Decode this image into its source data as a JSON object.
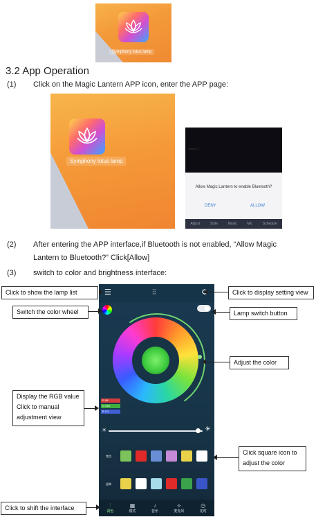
{
  "top_image": {
    "app_label": "Symphony lotus lamp"
  },
  "section": {
    "title": "3.2 App Operation"
  },
  "steps": [
    {
      "num": "(1)",
      "line1": "Click on the Magic Lantern APP icon, enter the APP page:",
      "line2": ""
    },
    {
      "num": "(2)",
      "line1": "After entering the APP interface,if Bluetooth is not enabled, “Allow Magic",
      "line2": "Lantern to Bluetooth?” Click[Allow]"
    },
    {
      "num": "(3)",
      "line1": "switch to color and brightness interface:",
      "line2": ""
    }
  ],
  "big_image": {
    "app_label": "Symphony lotus lamp"
  },
  "bluetooth_dialog": {
    "screen_sub": "Speed 0",
    "message": "Allow Magic Lantern to enable Bluetooth?",
    "deny": "DENY",
    "allow": "ALLOW",
    "tabs": [
      "Adjust",
      "Style",
      "Music",
      "Mic",
      "Schedule"
    ]
  },
  "phone": {
    "rgb": [
      {
        "label": "R",
        "value": "58",
        "color": "#d33c3c"
      },
      {
        "label": "G",
        "value": "240",
        "color": "#3fae3f"
      },
      {
        "label": "B",
        "value": "111",
        "color": "#3f5fd3"
      }
    ],
    "row1_label": "常用",
    "row2_label": "经典",
    "row1_colors": [
      "#7cc25a",
      "#e02a2a",
      "#6a8fd6",
      "#c48ad6",
      "#e9d24a",
      "#ffffff"
    ],
    "row2_colors": [
      "#e9d24a",
      "#ffffff",
      "#a6dde8",
      "#e02a2a",
      "#3aa24a",
      "#3a55c8"
    ],
    "tabs": [
      {
        "icon": "⫶",
        "label": "调色"
      },
      {
        "icon": "▦",
        "label": "模式"
      },
      {
        "icon": "♪",
        "label": "音乐"
      },
      {
        "icon": "⟡",
        "label": "麦克风"
      },
      {
        "icon": "◷",
        "label": "定时"
      }
    ]
  },
  "callouts": {
    "lamp_list": "Click to show the lamp list",
    "setting_view": "Click to display setting view",
    "color_wheel": "Switch the color wheel",
    "lamp_switch": "Lamp switch button",
    "adjust_color": "Adjust the color",
    "rgb_line1": "Display the RGB value",
    "rgb_line2": "Click to manual",
    "rgb_line3": "adjustment view",
    "square_line1": "Click square icon to",
    "square_line2": "adjust the color",
    "shift_interface": "Click to shift the interface"
  }
}
